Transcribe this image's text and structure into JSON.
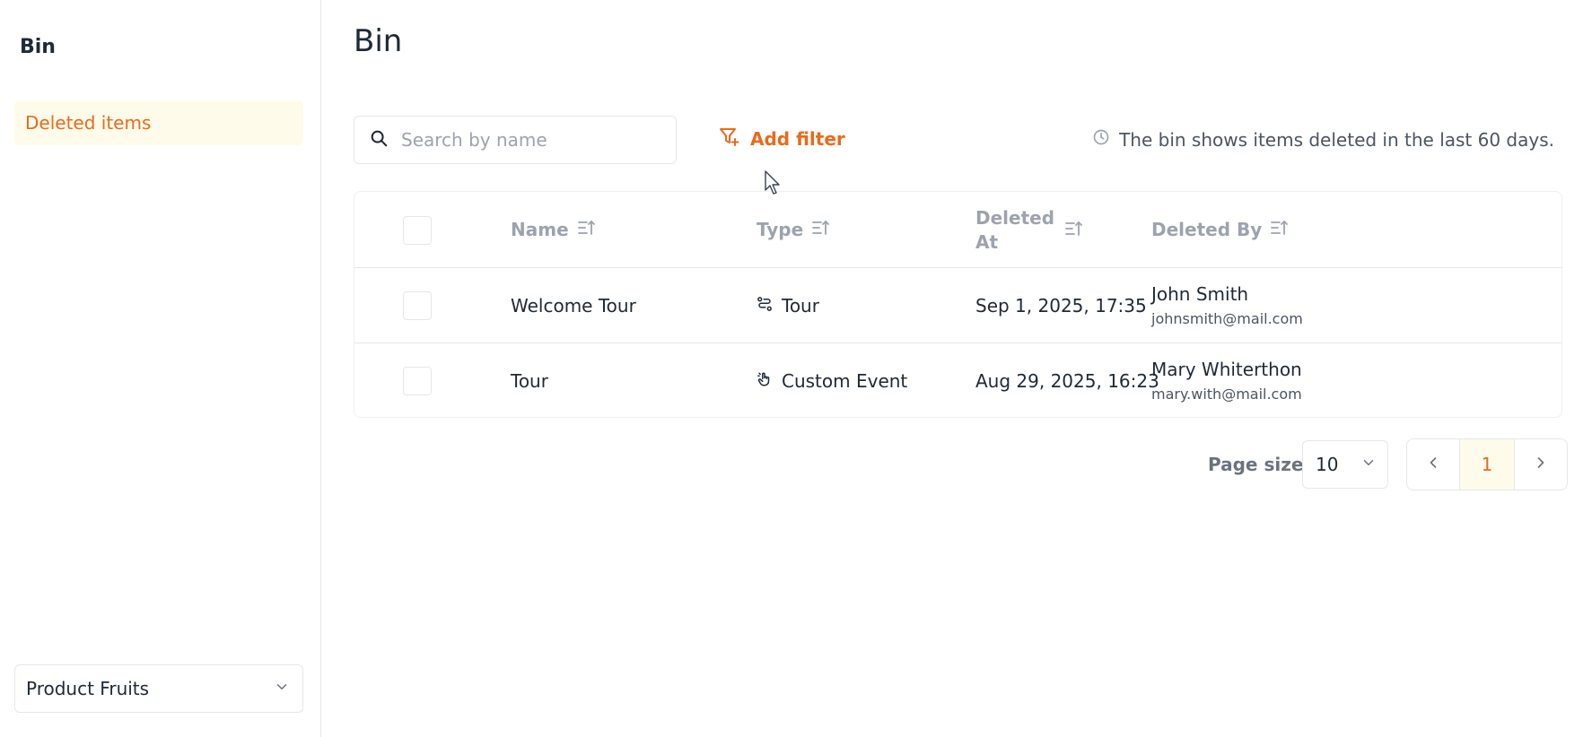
{
  "sidebar": {
    "title": "Bin",
    "items": [
      {
        "label": "Deleted items"
      }
    ],
    "workspace": "Product Fruits"
  },
  "main": {
    "title": "Bin",
    "search": {
      "placeholder": "Search by name",
      "value": ""
    },
    "add_filter_label": "Add filter",
    "bin_info": "The bin shows items deleted in the last 60 days."
  },
  "table": {
    "headers": {
      "name": "Name",
      "type": "Type",
      "deleted_at": "Deleted At",
      "deleted_by": "Deleted By"
    },
    "rows": [
      {
        "name": "Welcome Tour",
        "type": "Tour",
        "type_icon": "tour-icon",
        "deleted_at": "Sep 1, 2025, 17:35",
        "user_name": "John Smith",
        "user_email": "johnsmith@mail.com"
      },
      {
        "name": "Tour",
        "type": "Custom Event",
        "type_icon": "hand-pointer-icon",
        "deleted_at": "Aug 29, 2025, 16:23",
        "user_name": "Mary Whiterthon",
        "user_email": "mary.with@mail.com"
      }
    ]
  },
  "pagination": {
    "page_size_label": "Page size",
    "page_size": "10",
    "current_page": "1"
  },
  "colors": {
    "accent": "#ea6a1c",
    "accent_bg": "#fffbeb",
    "muted": "#9ca3af"
  }
}
